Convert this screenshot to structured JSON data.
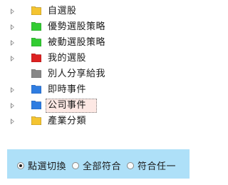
{
  "tree": {
    "items": [
      {
        "label": "自選股",
        "folder_color": "#f4c430",
        "expandable": true
      },
      {
        "label": "優勢選股策略",
        "folder_color": "#33cc33",
        "expandable": true
      },
      {
        "label": "被動選股策略",
        "folder_color": "#33cc33",
        "expandable": true
      },
      {
        "label": "我的選股",
        "folder_color": "#dd2222",
        "expandable": true
      },
      {
        "label": "別人分享給我",
        "folder_color": "#888888",
        "expandable": false
      },
      {
        "label": "即時事件",
        "folder_color": "#2f7de1",
        "expandable": true
      },
      {
        "label": "公司事件",
        "folder_color": "#2f7de1",
        "expandable": true,
        "selected": true
      },
      {
        "label": "產業分類",
        "folder_color": "#f4c430",
        "expandable": true
      }
    ]
  },
  "filter": {
    "options": [
      {
        "label": "點選切換",
        "checked": true
      },
      {
        "label": "全部符合",
        "checked": false
      },
      {
        "label": "符合任一",
        "checked": false
      }
    ]
  }
}
